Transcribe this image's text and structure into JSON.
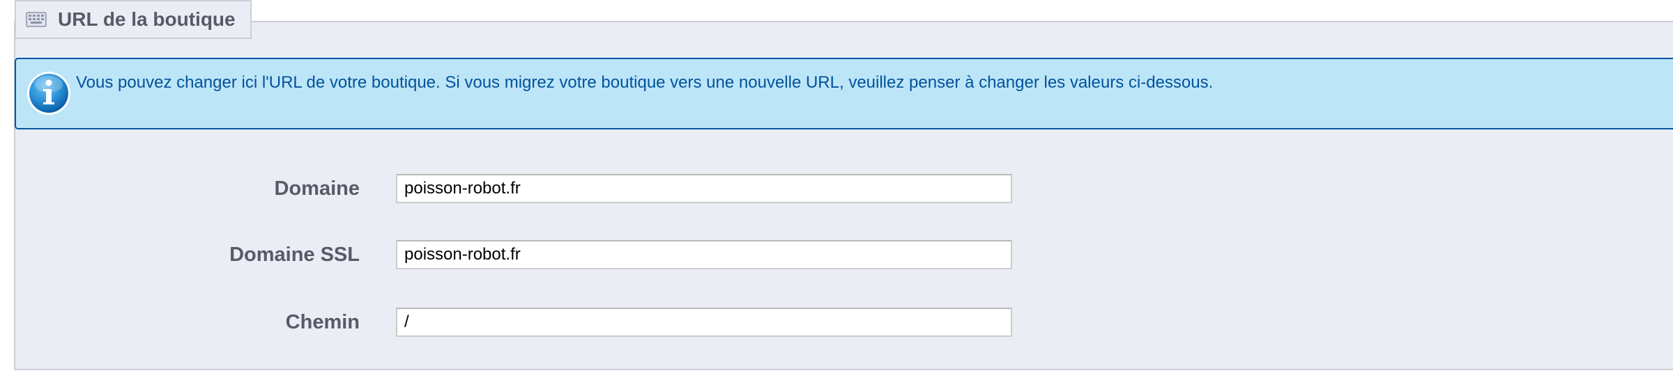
{
  "section": {
    "title": "URL de la boutique",
    "icon": "keyboard-icon"
  },
  "alert": {
    "icon": "info-icon",
    "message": "Vous pouvez changer ici l'URL de votre boutique. Si vous migrez votre boutique vers une nouvelle URL, veuillez penser à changer les valeurs ci-dessous.",
    "background_color": "#bde5f8",
    "border_color": "#0055a4",
    "text_color": "#00529b"
  },
  "form": {
    "domain": {
      "label": "Domaine",
      "value": "poisson-robot.fr"
    },
    "domain_ssl": {
      "label": "Domaine SSL",
      "value": "poisson-robot.fr"
    },
    "path": {
      "label": "Chemin",
      "value": "/"
    }
  },
  "colors": {
    "panel_background": "#ebedf4",
    "panel_border": "#ccced7",
    "label_text": "#585a69"
  }
}
